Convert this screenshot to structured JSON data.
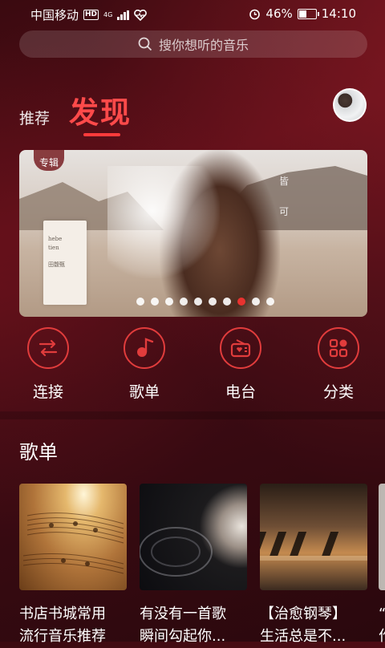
{
  "status_bar": {
    "carrier": "中国移动",
    "hd": "HD",
    "network": "4G",
    "battery_percent": "46%",
    "time": "14:10"
  },
  "search": {
    "placeholder": "搜你想听的音乐"
  },
  "tabs": {
    "recommend": "推荐",
    "discover": "发现"
  },
  "banner": {
    "badge": "专辑",
    "card_lines": [
      "hebe",
      "tien",
      "田馥甄"
    ],
    "side_text": [
      "皆",
      "可"
    ],
    "dots_total": 10,
    "dots_active_index": 7
  },
  "quick_entries": [
    {
      "label": "连接",
      "icon": "connect-icon"
    },
    {
      "label": "歌单",
      "icon": "music-note-icon"
    },
    {
      "label": "电台",
      "icon": "radio-icon"
    },
    {
      "label": "分类",
      "icon": "category-icon"
    }
  ],
  "playlist_section": {
    "title": "歌单",
    "items": [
      {
        "line1": "书店书城常用",
        "line2": "流行音乐推荐"
      },
      {
        "line1": "有没有一首歌",
        "line2": "瞬间勾起你..."
      },
      {
        "line1": "【治愈钢琴】",
        "line2": "生活总是不..."
      },
      {
        "line1": "“",
        "line2": "作"
      }
    ]
  },
  "colors": {
    "accent": "#e8322f",
    "background": "#4a0c15"
  }
}
